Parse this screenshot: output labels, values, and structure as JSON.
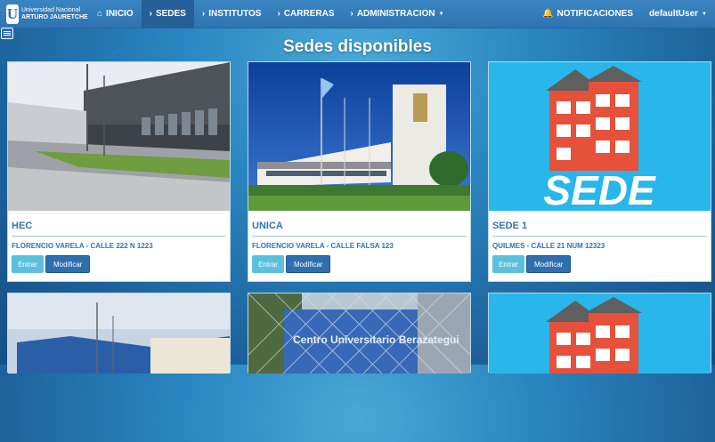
{
  "navbar": {
    "brand_top": "Universidad Nacional",
    "brand_bottom": "ARTURO JAURETCHE",
    "logo_letter": "U",
    "items": [
      {
        "label": "INICIO",
        "icon": "home-icon"
      },
      {
        "label": "SEDES",
        "icon": "chevron-right-icon",
        "active": true
      },
      {
        "label": "INSTITUTOS",
        "icon": "chevron-right-icon"
      },
      {
        "label": "CARRERAS",
        "icon": "chevron-right-icon"
      },
      {
        "label": "ADMINISTRACION",
        "icon": "chevron-right-icon",
        "dropdown": true
      }
    ],
    "notifications_label": "NOTIFICACIONES",
    "user_label": "defaultUser"
  },
  "page": {
    "title": "Sedes disponibles"
  },
  "cards": [
    {
      "title": "HEC",
      "address": "FLORENCIO VARELA - CALLE 222 N 1223",
      "enter_label": "Entrar",
      "edit_label": "Modificar",
      "image": "building-photo"
    },
    {
      "title": "UNICA",
      "address": "FLORENCIO VARELA - CALLE FALSA 123",
      "enter_label": "Entrar",
      "edit_label": "Modificar",
      "image": "building-photo"
    },
    {
      "title": "SEDE 1",
      "address": "QUILMES - CALLE 21 NUM 12323",
      "enter_label": "Entrar",
      "edit_label": "Modificar",
      "image": "sede-placeholder",
      "image_text": "SEDE"
    },
    {
      "image": "building-photo"
    },
    {
      "image": "building-photo",
      "image_text": "Centro Universitario Berazategui"
    },
    {
      "image": "sede-placeholder"
    }
  ],
  "colors": {
    "accent": "#2f74b2",
    "enter": "#5bc0de",
    "edit": "#2f6fae",
    "sede_bg": "#29b6ea",
    "sede_house": "#e5513a"
  }
}
